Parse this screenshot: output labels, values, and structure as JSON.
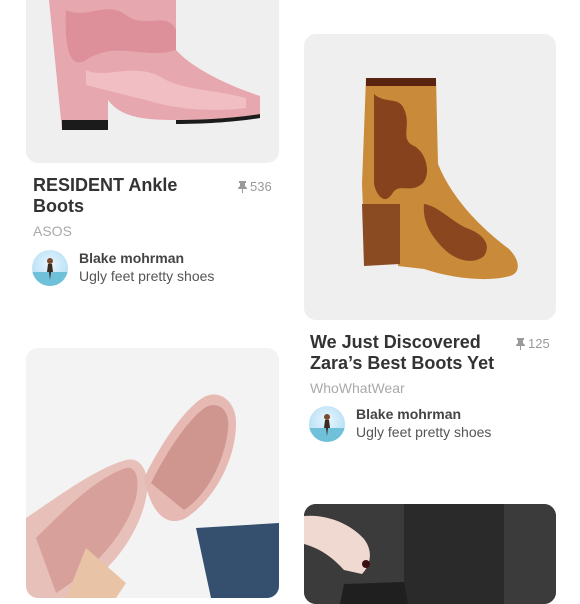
{
  "pins": [
    {
      "title": "RESIDENT Ankle Boots",
      "saves": "536",
      "source": "ASOS",
      "user": "Blake mohrman",
      "board": "Ugly feet pretty shoes"
    },
    {
      "title": "We Just Discovered Zara’s Best Boots Yet",
      "saves": "125",
      "source": "WhoWhatWear",
      "user": "Blake mohrman",
      "board": "Ugly feet pretty shoes"
    }
  ],
  "icons": {
    "save": "pin-icon"
  }
}
